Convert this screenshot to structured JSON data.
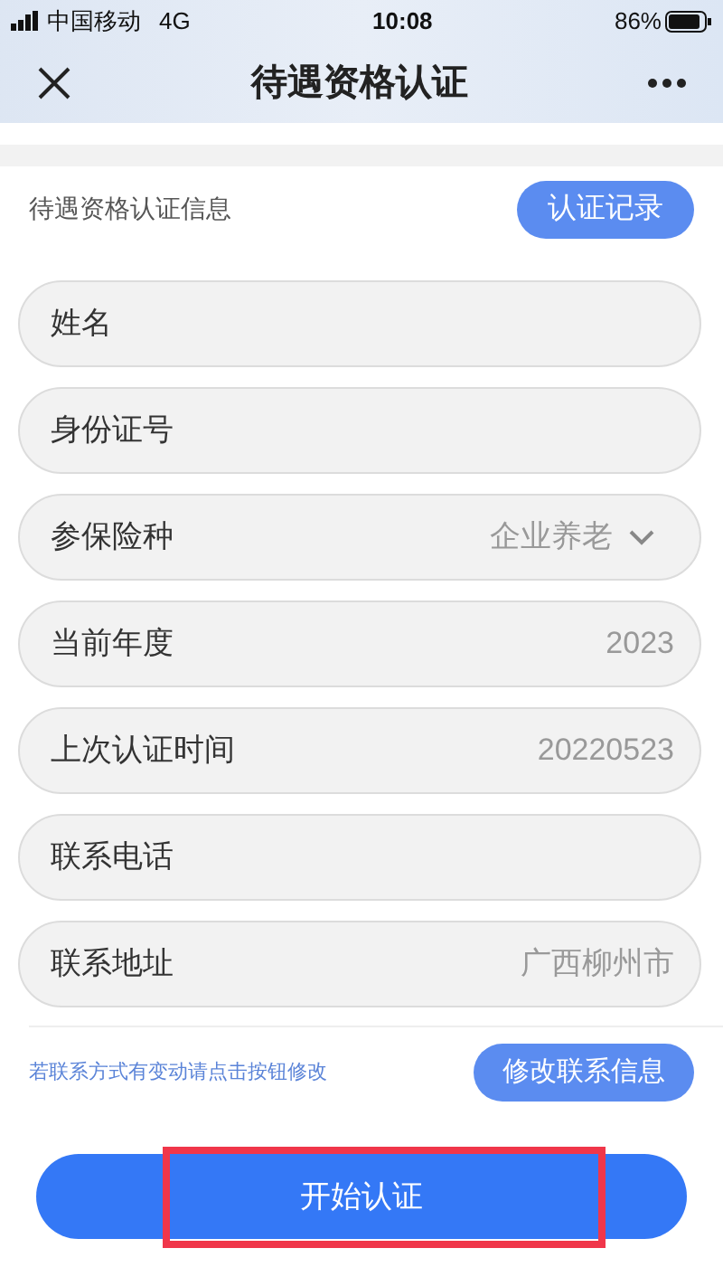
{
  "status_bar": {
    "carrier": "中国移动",
    "network": "4G",
    "time": "10:08",
    "battery": "86%"
  },
  "nav": {
    "title": "待遇资格认证"
  },
  "section": {
    "title": "待遇资格认证信息",
    "button": "认证记录"
  },
  "fields": [
    {
      "label": "姓名",
      "kind": "text"
    },
    {
      "label": "身份证号",
      "kind": "text"
    },
    {
      "label": "参保险种",
      "kind": "select",
      "value": "企业养老"
    },
    {
      "label": "当前年度",
      "kind": "text",
      "value": "2023"
    },
    {
      "label": "上次认证时间",
      "kind": "text",
      "value": "20220523"
    },
    {
      "label": "联系电话",
      "kind": "text"
    },
    {
      "label": "联系地址",
      "kind": "text",
      "value": "广西柳州市"
    }
  ],
  "tip": {
    "text": "若联系方式有变动请点击按钮修改",
    "button": "修改联系信息"
  },
  "start_button": {
    "label": "开始认证",
    "highlighted": true
  }
}
